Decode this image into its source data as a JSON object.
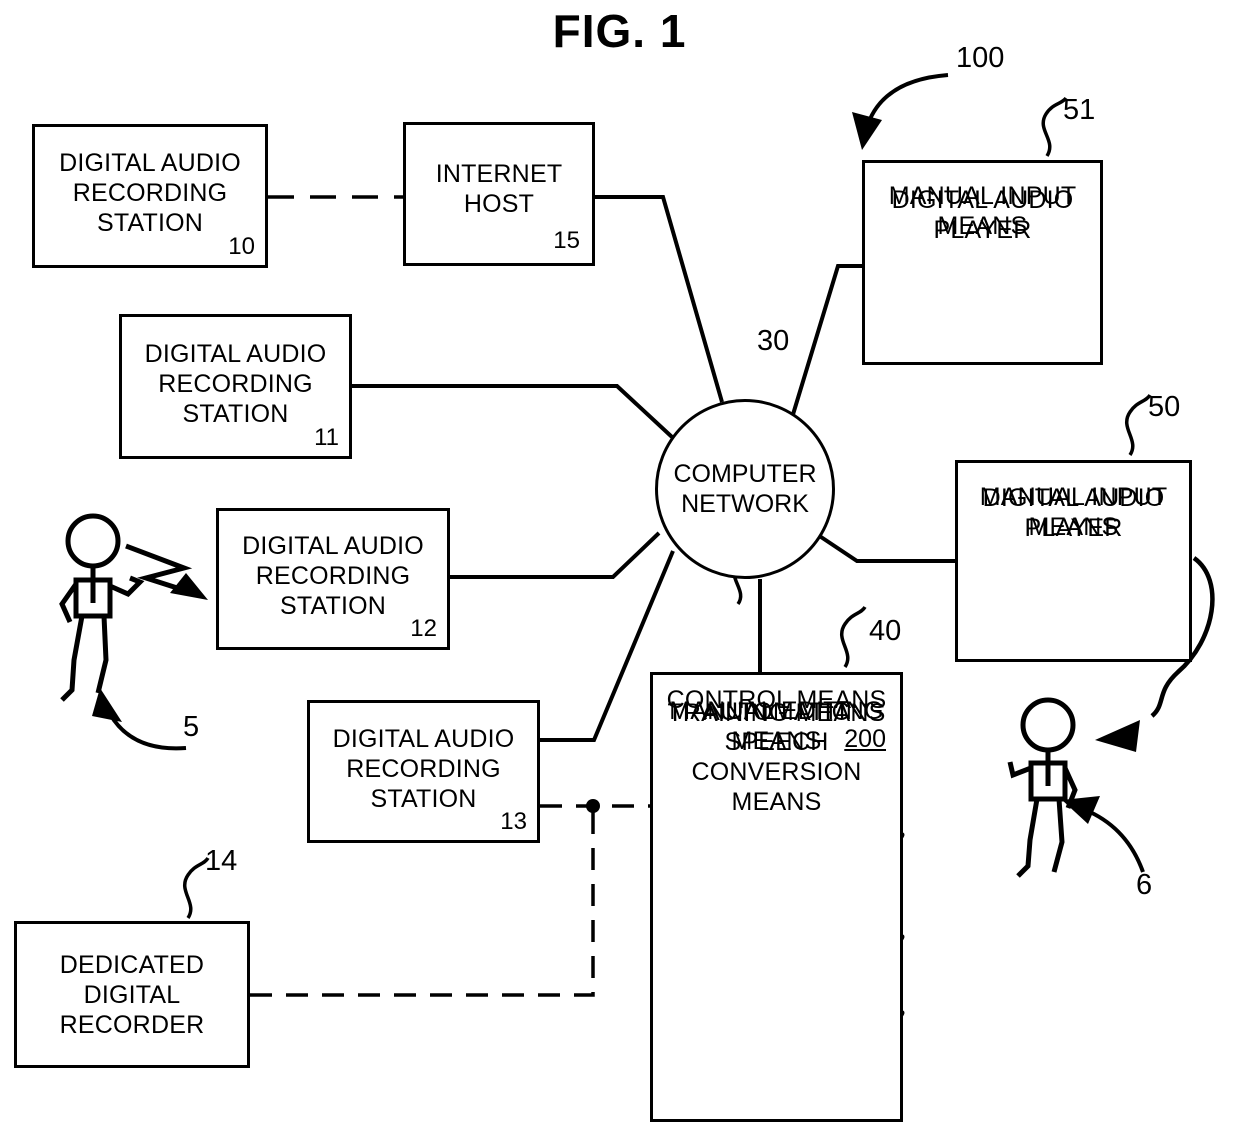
{
  "figure": {
    "title": "FIG. 1",
    "system_ref": "100"
  },
  "nodes": {
    "station10": {
      "label": "DIGITAL AUDIO\nRECORDING\nSTATION",
      "ref": "10"
    },
    "internet_host": {
      "label": "INTERNET\nHOST",
      "ref": "15"
    },
    "station11": {
      "label": "DIGITAL AUDIO\nRECORDING\nSTATION",
      "ref": "11"
    },
    "station12": {
      "label": "DIGITAL AUDIO\nRECORDING\nSTATION",
      "ref": "12"
    },
    "station13": {
      "label": "DIGITAL AUDIO\nRECORDING\nSTATION",
      "ref": "13"
    },
    "dedicated_recorder": {
      "label": "DEDICATED\nDIGITAL\nRECORDER",
      "ref": "14"
    },
    "computer_network": {
      "label": "COMPUTER\nNETWORK",
      "ref": "30"
    },
    "player51": {
      "ref": "51",
      "sections": [
        {
          "label": "DIGITAL AUDIO\nPLAYER"
        },
        {
          "label": "MANUAL INPUT\nMEANS"
        }
      ]
    },
    "player50": {
      "ref": "50",
      "sections": [
        {
          "label": "DIGITAL AUDIO\nPLAYER"
        },
        {
          "label": "MANUAL INPUT\nMEANS"
        }
      ]
    },
    "conversion_unit": {
      "ref": "40",
      "sections": [
        {
          "label": "AUTOMATIC\nSPEECH\nCONVERSION\nMEANS"
        },
        {
          "label": "MANUAL EDITING\nMEANS"
        },
        {
          "label": "TRAINING MEANS"
        },
        {
          "label": "CONTROL MEANS",
          "sub_ref": "200"
        }
      ]
    },
    "person5": {
      "ref": "5"
    },
    "person6": {
      "ref": "6"
    }
  },
  "style": {
    "line_color": "#000000",
    "background": "#ffffff"
  }
}
